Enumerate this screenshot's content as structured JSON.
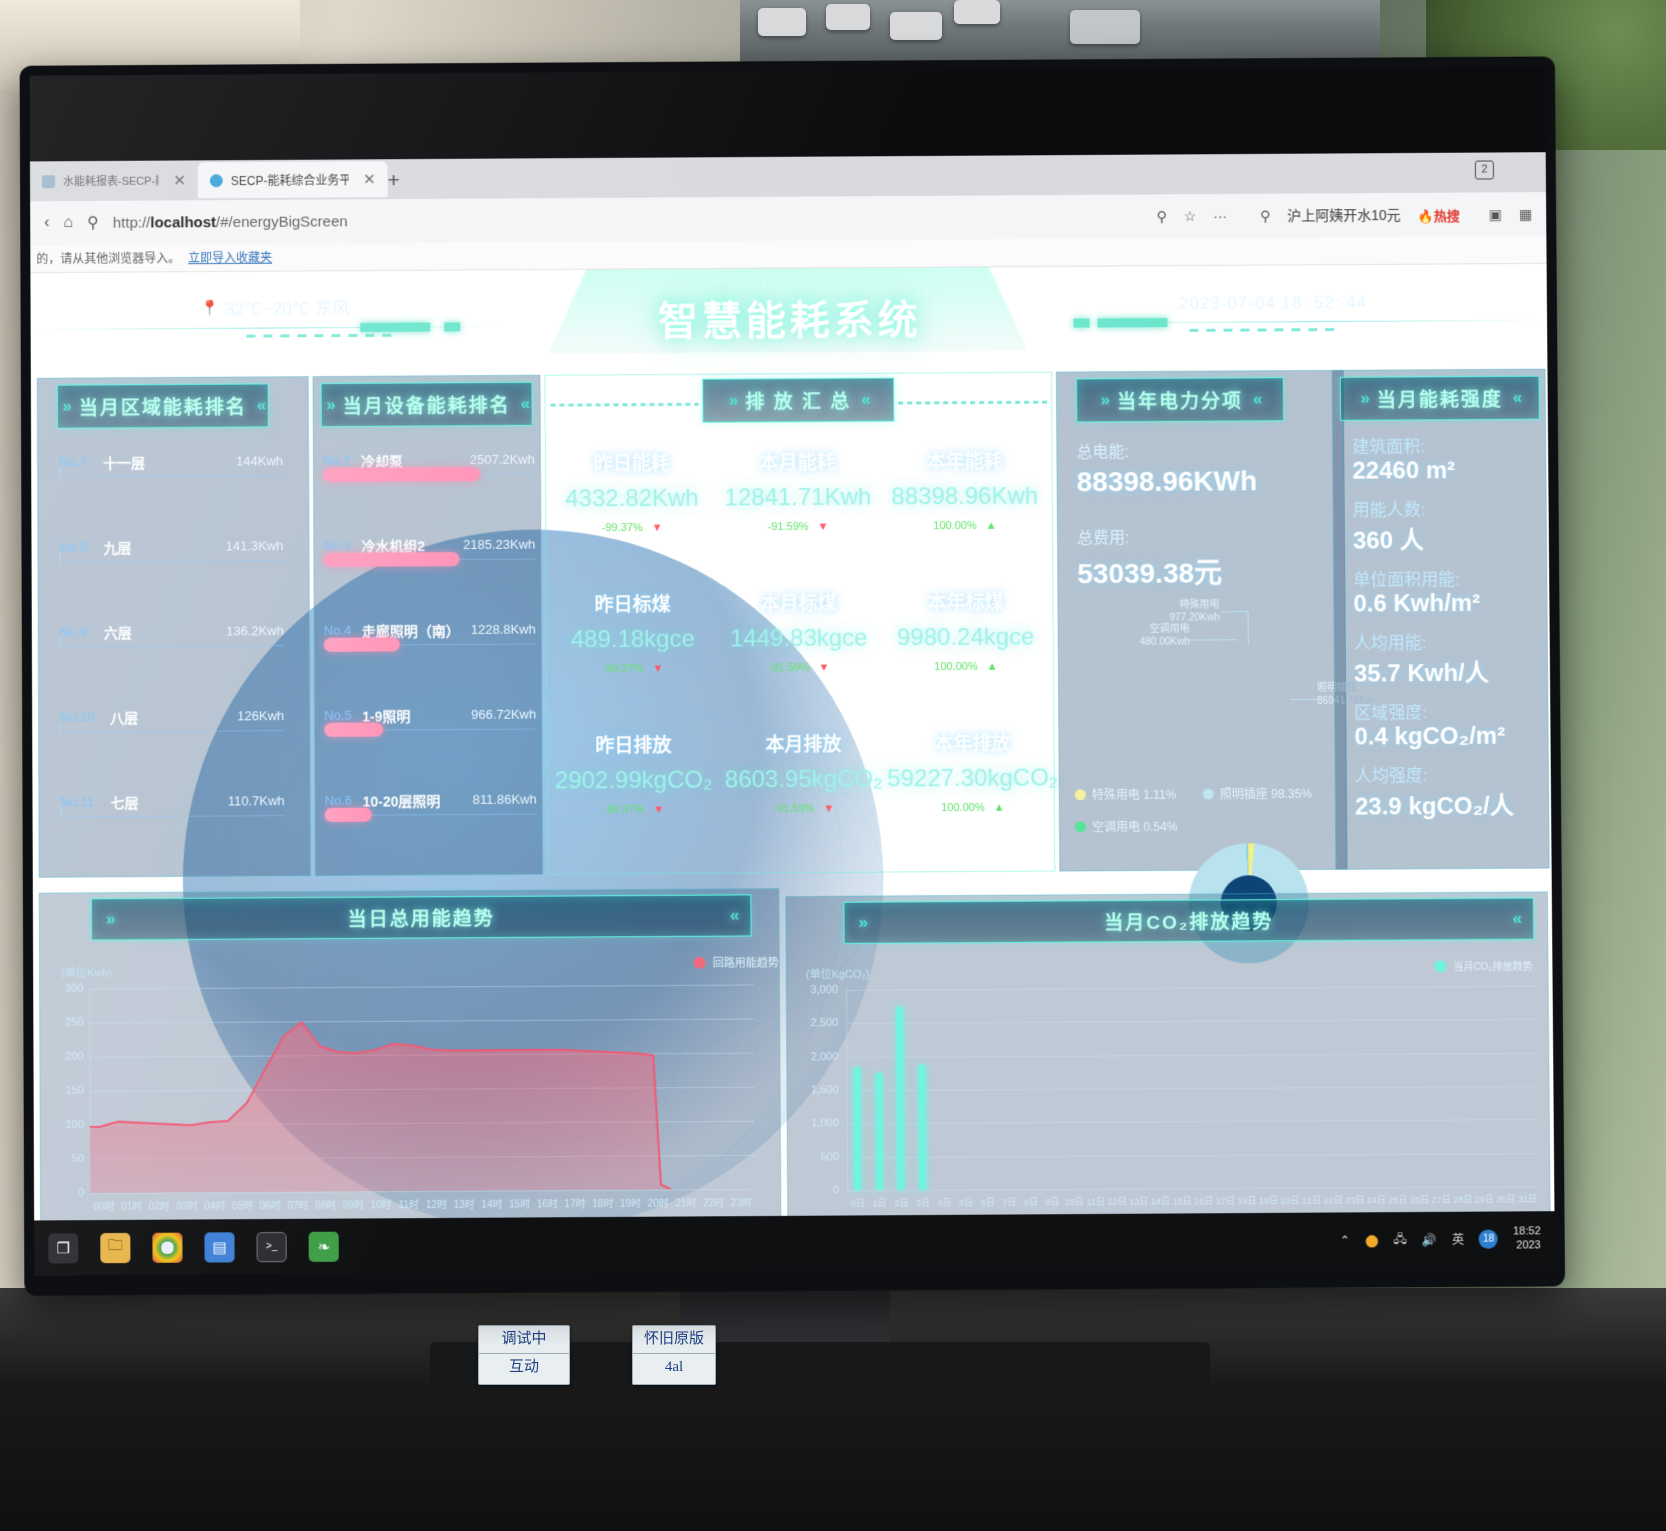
{
  "browser": {
    "tabs": [
      {
        "title": "水能耗报表-SECP-能耗综合",
        "active": false
      },
      {
        "title": "SECP-能耗综合业务平台",
        "active": true
      }
    ],
    "new_tab_label": "+",
    "tab_count_badge": "2",
    "url_prefix": "http://",
    "url_host": "localhost",
    "url_path": "/#/energyBigScreen",
    "url_full": "http://localhost/#/energyBigScreen",
    "toolbar_icons": [
      "back-icon",
      "home-icon",
      "search-icon"
    ],
    "right_icons": [
      "zoom-icon",
      "bookmark-star-icon",
      "more-icon"
    ],
    "search_suggest": "沪上阿姨开水10元",
    "hot_label": "热搜",
    "infobar_text": "的，请从其他浏览器导入。",
    "infobar_link": "立即导入收藏夹"
  },
  "header": {
    "weather_icon": "location-pin-icon",
    "weather": "32℃~20℃ 东风",
    "title": "智慧能耗系统",
    "datetime": "2023-07-04 18: 52: 44"
  },
  "area_ranking": {
    "title": "当月区域能耗排名",
    "rows": [
      {
        "no": "No.7",
        "name": "十一层",
        "value": "144Kwh",
        "pct": 2
      },
      {
        "no": "No.8",
        "name": "九层",
        "value": "141.3Kwh",
        "pct": 2
      },
      {
        "no": "No.9",
        "name": "六层",
        "value": "136.2Kwh",
        "pct": 2
      },
      {
        "no": "No.10",
        "name": "八层",
        "value": "126Kwh",
        "pct": 2
      },
      {
        "no": "No.11",
        "name": "七层",
        "value": "110.7Kwh",
        "pct": 2
      }
    ]
  },
  "device_ranking": {
    "title": "当月设备能耗排名",
    "rows": [
      {
        "no": "No.2",
        "name": "冷却泵",
        "value": "2507.2Kwh",
        "pct": 100
      },
      {
        "no": "No.3",
        "name": "冷水机组2",
        "value": "2185.23Kwh",
        "pct": 87
      },
      {
        "no": "No.4",
        "name": "走廊照明（南）",
        "value": "1228.8Kwh",
        "pct": 49
      },
      {
        "no": "No.5",
        "name": "1-9照明",
        "value": "966.72Kwh",
        "pct": 38
      },
      {
        "no": "No.6",
        "name": "10-20层照明",
        "value": "811.86Kwh",
        "pct": 32
      }
    ]
  },
  "emission_summary": {
    "title": "排 放 汇 总",
    "cells": [
      {
        "label": "昨日能耗",
        "value": "4332.82Kwh",
        "delta": "-99.37%",
        "dir": "down"
      },
      {
        "label": "本月能耗",
        "value": "12841.71Kwh",
        "delta": "-91.59%",
        "dir": "down"
      },
      {
        "label": "本年能耗",
        "value": "88398.96Kwh",
        "delta": "100.00%",
        "dir": "up"
      },
      {
        "label": "昨日标煤",
        "value": "489.18kgce",
        "delta": "-99.37%",
        "dir": "down"
      },
      {
        "label": "本月标煤",
        "value": "1449.83kgce",
        "delta": "-91.59%",
        "dir": "down"
      },
      {
        "label": "本年标煤",
        "value": "9980.24kgce",
        "delta": "100.00%",
        "dir": "up"
      },
      {
        "label": "昨日排放",
        "value": "2902.99kgCO₂",
        "delta": "-99.37%",
        "dir": "down"
      },
      {
        "label": "本月排放",
        "value": "8603.95kgCO₂",
        "delta": "-91.59%",
        "dir": "down"
      },
      {
        "label": "本年排放",
        "value": "59227.30kgCO₂",
        "delta": "100.00%",
        "dir": "up"
      }
    ]
  },
  "electricity": {
    "title": "当年电力分项",
    "total_energy_label": "总电能:",
    "total_energy_value": "88398.96KWh",
    "total_cost_label": "总费用:",
    "total_cost_value": "53039.38元",
    "callouts": [
      {
        "name": "特殊用电",
        "value": "977.20Kwh"
      },
      {
        "name": "空调用电",
        "value": "480.00Kwh"
      },
      {
        "name": "照明插座",
        "value": "86941.76Kw"
      }
    ],
    "legend": [
      {
        "label": "特殊用电 1.11%",
        "color": "#f5f0a0"
      },
      {
        "label": "照明插座 98.35%",
        "color": "#bfe4f2"
      },
      {
        "label": "空调用电 0.54%",
        "color": "#56e39b"
      }
    ]
  },
  "intensity": {
    "title": "当月能耗强度",
    "items": [
      {
        "label": "建筑面积:",
        "value": "22460 m²"
      },
      {
        "label": "用能人数:",
        "value": "360 人"
      },
      {
        "label": "单位面积用能:",
        "value": "0.6 Kwh/m²"
      },
      {
        "label": "人均用能:",
        "value": "35.7 Kwh/人"
      },
      {
        "label": "区域强度:",
        "value": "0.4 kgCO₂/m²"
      },
      {
        "label": "人均强度:",
        "value": "23.9 kgCO₂/人"
      }
    ]
  },
  "chart_data": [
    {
      "type": "area",
      "panel_title": "当日总用能趋势",
      "title": "当日总用能趋势",
      "unit_label": "(单位Kwh)",
      "legend": [
        "回路用能趋势"
      ],
      "legend_color": "#f26a7e",
      "xlabel": "",
      "ylabel": "",
      "ylim": [
        0,
        300
      ],
      "yticks": [
        0,
        50,
        100,
        150,
        200,
        250,
        300
      ],
      "grid": true,
      "categories": [
        "00时",
        "01时",
        "02时",
        "03时",
        "04时",
        "05时",
        "06时",
        "07时",
        "08时",
        "09时",
        "10时",
        "11时",
        "12时",
        "13时",
        "14时",
        "15时",
        "16时",
        "17时",
        "18时",
        "19时",
        "20时",
        "21时",
        "22时",
        "23时"
      ],
      "series": [
        {
          "name": "回路用能趋势",
          "values": [
            97,
            105,
            103,
            101,
            100,
            99,
            102,
            104,
            130,
            180,
            228,
            248,
            213,
            205,
            202,
            207,
            215,
            213,
            206,
            7,
            0,
            0,
            0,
            0
          ]
        }
      ]
    },
    {
      "type": "bar",
      "panel_title": "当月CO₂排放趋势",
      "title": "当月CO₂排放趋势",
      "unit_label": "(单位KgCO₂)",
      "legend": [
        "当月CO₂排放趋势"
      ],
      "legend_color": "#6ff4e0",
      "xlabel": "",
      "ylabel": "",
      "ylim": [
        0,
        3000
      ],
      "yticks": [
        "0",
        "500",
        "1,000",
        "1,500",
        "2,000",
        "2,500",
        "3,000"
      ],
      "grid": true,
      "categories": [
        "0日",
        "1日",
        "2日",
        "3日",
        "4日",
        "5日",
        "6日",
        "7日",
        "8日",
        "9日",
        "10日",
        "11日",
        "12日",
        "13日",
        "14日",
        "15日",
        "16日",
        "17日",
        "18日",
        "19日",
        "20日",
        "21日",
        "22日",
        "23日",
        "24日",
        "25日",
        "26日",
        "27日",
        "28日",
        "29日",
        "30日",
        "31日"
      ],
      "values": [
        1850,
        1760,
        2750,
        1870,
        0,
        0,
        0,
        0,
        0,
        0,
        0,
        0,
        0,
        0,
        0,
        0,
        0,
        0,
        0,
        0,
        0,
        0,
        0,
        0,
        0,
        0,
        0,
        0,
        0,
        0,
        0,
        0
      ]
    }
  ],
  "taskbar": {
    "icons": [
      "task-view-icon",
      "file-explorer-icon",
      "chrome-icon",
      "app-blue-icon",
      "terminal-icon",
      "leaf-app-icon"
    ],
    "tray_icons": [
      "chevron-up-icon",
      "shield-icon",
      "network-icon",
      "volume-icon"
    ],
    "ime": "英",
    "ime_badge": "18",
    "clock": "18:52",
    "date": "2023"
  },
  "desk": {
    "stickers": [
      {
        "line1": "调试中",
        "line2": "互动"
      },
      {
        "line1": "怀旧原版",
        "line2": "4al"
      }
    ]
  }
}
